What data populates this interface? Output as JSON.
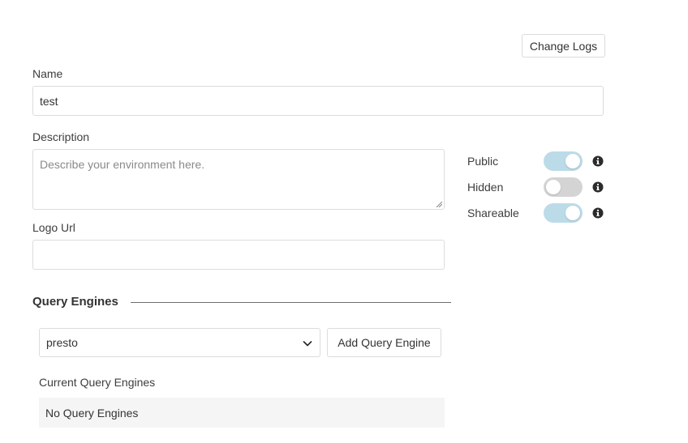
{
  "header": {
    "change_logs_label": "Change Logs"
  },
  "form": {
    "name": {
      "label": "Name",
      "value": "test"
    },
    "description": {
      "label": "Description",
      "value": "",
      "placeholder": "Describe your environment here."
    },
    "logo_url": {
      "label": "Logo Url",
      "value": ""
    }
  },
  "toggles": [
    {
      "label": "Public",
      "checked": true,
      "icon": "info-icon"
    },
    {
      "label": "Hidden",
      "checked": false,
      "icon": "info-icon"
    },
    {
      "label": "Shareable",
      "checked": true,
      "icon": "info-icon"
    }
  ],
  "query_engines": {
    "section_title": "Query Engines",
    "selected_engine": "presto",
    "add_button_label": "Add Query Engine",
    "current_label": "Current Query Engines",
    "empty_text": "No Query Engines"
  },
  "colors": {
    "toggle_on": "#bcdbe8",
    "toggle_off": "#d4d4d4",
    "border": "#dcdcdc",
    "icon": "#2b2b2b"
  }
}
